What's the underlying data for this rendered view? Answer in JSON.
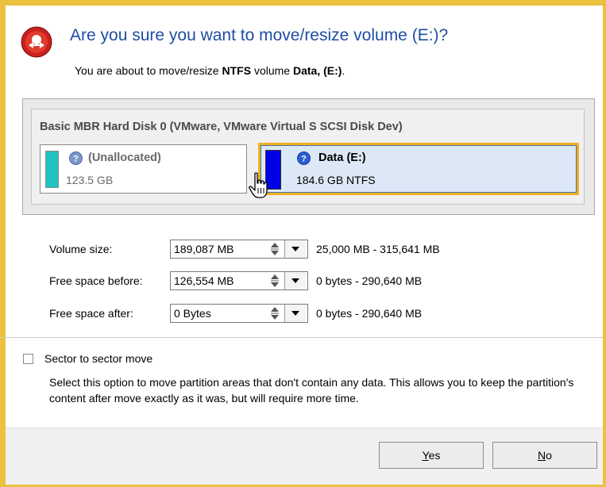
{
  "dialog": {
    "title": "Are you sure you want to move/resize volume (E:)?",
    "subtitle_prefix": "You are about to move/resize ",
    "subtitle_fs": "NTFS",
    "subtitle_mid": " volume ",
    "subtitle_volume": "Data, (E:)",
    "subtitle_suffix": "."
  },
  "disk": {
    "label": "Basic MBR Hard Disk 0 (VMware, VMware Virtual S SCSI Disk Dev)",
    "partitions": [
      {
        "name": "(Unallocated)",
        "size": "123.5 GB",
        "color": "#1fc4c0",
        "selected": false
      },
      {
        "name": "Data (E:)",
        "size": "184.6 GB NTFS",
        "color": "#0000e6",
        "selected": true
      }
    ]
  },
  "fields": [
    {
      "label": "Volume size:",
      "value": "189,087 MB",
      "range": "25,000 MB - 315,641 MB"
    },
    {
      "label": "Free space before:",
      "value": "126,554 MB",
      "range": "0 bytes - 290,640 MB"
    },
    {
      "label": "Free space after:",
      "value": "0 Bytes",
      "range": "0 bytes - 290,640 MB"
    }
  ],
  "sector_move": {
    "label": "Sector to sector move",
    "checked": false,
    "description": "Select this option to move partition areas that don't contain any data. This allows you to keep the partition's content after move exactly as it was, but will require more time."
  },
  "buttons": {
    "yes_accel": "Y",
    "yes_rest": "es",
    "no_accel": "N",
    "no_rest": "o"
  },
  "colors": {
    "frame": "#ebc13f",
    "title": "#1f4ea3",
    "selected_border": "#f0b020"
  },
  "icons": {
    "header": "partition-move-icon",
    "partition": "question-icon",
    "cursor": "hand-pointer-icon"
  }
}
